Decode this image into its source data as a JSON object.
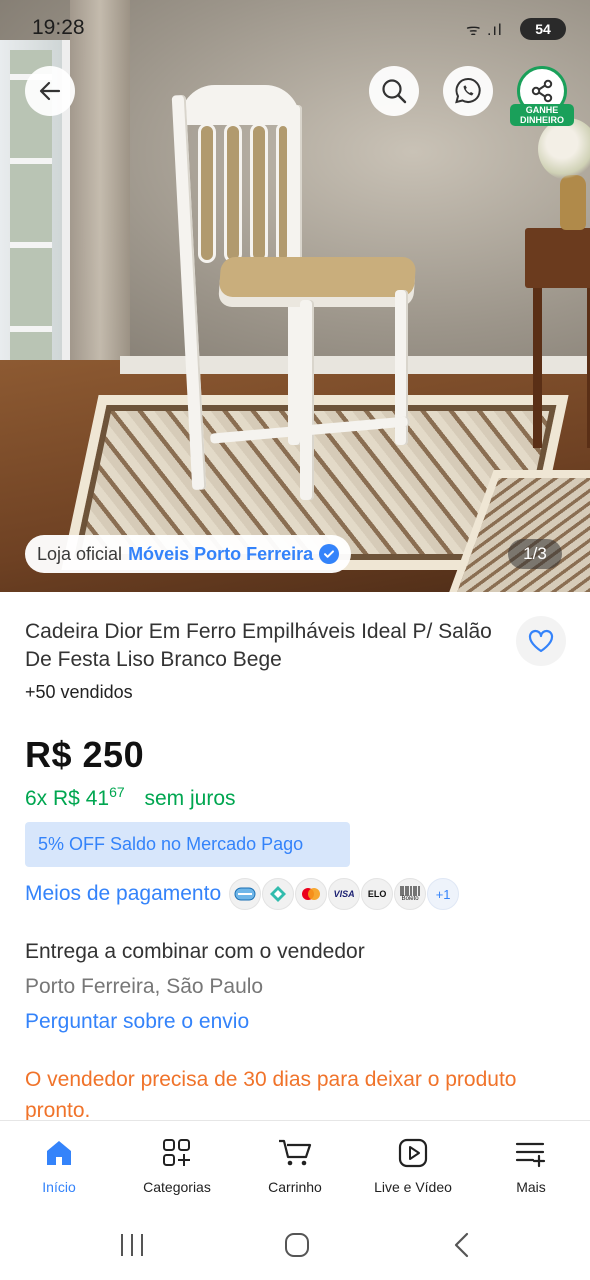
{
  "status_bar": {
    "time": "19:28",
    "battery": "54",
    "signal": "ᯤ .ıl"
  },
  "top_actions": {
    "share_badge": "GANHE DINHEIRO"
  },
  "gallery": {
    "counter": "1/3"
  },
  "store": {
    "prefix": "Loja oficial",
    "name": "Móveis Porto Ferreira"
  },
  "product": {
    "title": "Cadeira Dior Em Ferro Empilháveis Ideal P/ Salão De Festa Liso Branco Bege",
    "sold": "+50 vendidos",
    "price": "R$ 250",
    "installments": {
      "count": "6x R$ 41",
      "cents": "67",
      "note": "sem juros"
    },
    "promo": "5% OFF Saldo no Mercado Pago"
  },
  "payment": {
    "label": "Meios de pagamento",
    "methods": [
      "credit-card-icon",
      "pix-icon",
      "mastercard-icon",
      "VISA",
      "ELO",
      "Boleto"
    ],
    "more": "+1"
  },
  "delivery": {
    "line1": "Entrega a combinar com o vendedor",
    "location": "Porto Ferreira, São Paulo",
    "link": "Perguntar sobre o envio"
  },
  "warning": "O vendedor precisa de 30 dias para deixar o produto pronto.",
  "nav": [
    {
      "label": "Início",
      "icon": "home-icon",
      "active": true
    },
    {
      "label": "Categorias",
      "icon": "categories-icon",
      "active": false
    },
    {
      "label": "Carrinho",
      "icon": "cart-icon",
      "active": false
    },
    {
      "label": "Live e Vídeo",
      "icon": "play-icon",
      "active": false
    },
    {
      "label": "Mais",
      "icon": "menu-icon",
      "active": false
    }
  ],
  "colors": {
    "accent": "#3483fa",
    "green": "#00a650",
    "warning": "#f0732a",
    "share_green": "#1aa05a"
  }
}
